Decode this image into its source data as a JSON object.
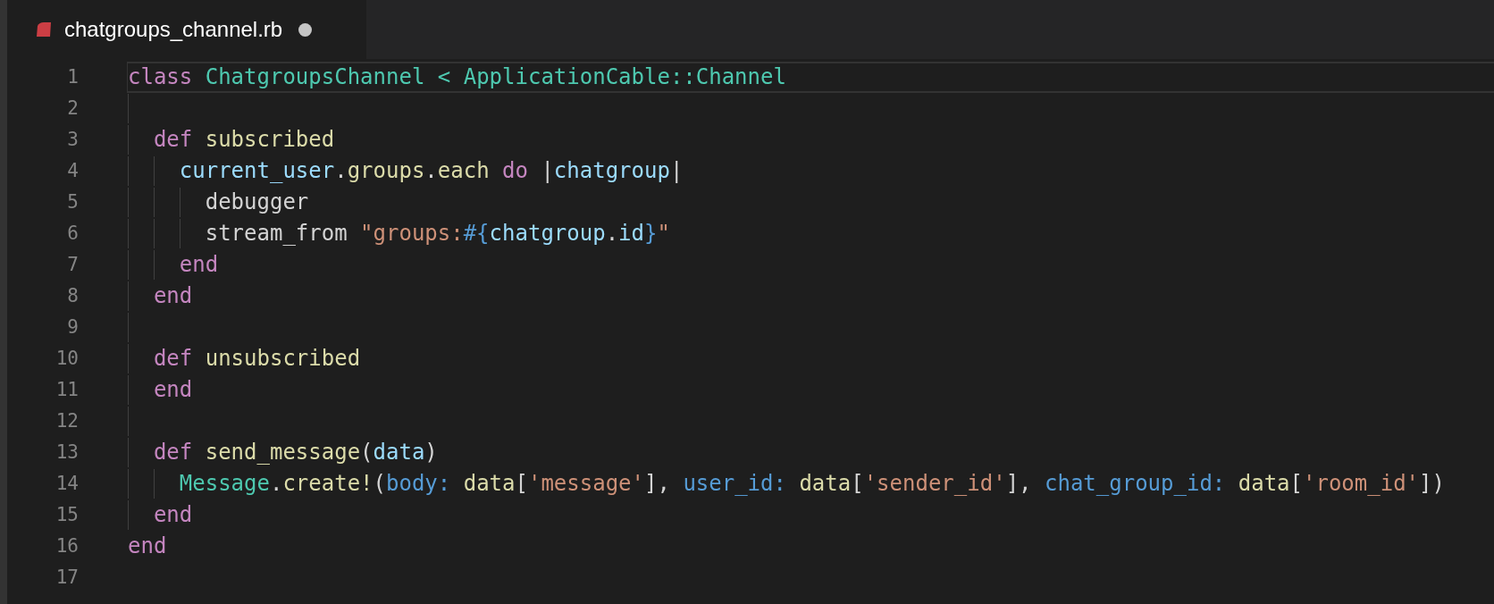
{
  "tab": {
    "title": "chatgroups_channel.rb",
    "modified": true,
    "selected": true
  },
  "lines": [
    {
      "number": "1",
      "current": true,
      "tokens": [
        {
          "kind": "keyword",
          "text": "class "
        },
        {
          "kind": "type",
          "text": "ChatgroupsChannel < ApplicationCable::Channel"
        }
      ],
      "children": [
        {
          "number": "2",
          "current": false
        },
        {
          "number": "3",
          "current": false,
          "tokens": [
            {
              "kind": "keyword",
              "text": "def "
            },
            {
              "kind": "function",
              "text": "subscribed"
            }
          ],
          "children": [
            {
              "number": "4",
              "current": false,
              "tokens": [
                {
                  "kind": "variable",
                  "text": "current_user"
                },
                {
                  "kind": "plain",
                  "text": "."
                },
                {
                  "kind": "function",
                  "text": "groups"
                },
                {
                  "kind": "plain",
                  "text": "."
                },
                {
                  "kind": "function",
                  "text": "each"
                },
                {
                  "kind": "keyword",
                  "text": " do"
                },
                {
                  "kind": "plain",
                  "text": " |"
                },
                {
                  "kind": "variable",
                  "text": "chatgroup"
                },
                {
                  "kind": "plain",
                  "text": "|"
                }
              ],
              "children": [
                {
                  "number": "5",
                  "current": false,
                  "tokens": [
                    {
                      "kind": "plain",
                      "text": "debugger"
                    }
                  ]
                },
                {
                  "number": "6",
                  "current": false,
                  "tokens": [
                    {
                      "kind": "plain",
                      "text": "stream_from "
                    },
                    {
                      "kind": "string",
                      "text": "\"groups:"
                    },
                    {
                      "kind": "symbol",
                      "text": "#{"
                    },
                    {
                      "kind": "variable",
                      "text": "chatgroup"
                    },
                    {
                      "kind": "plain",
                      "text": "."
                    },
                    {
                      "kind": "variable",
                      "text": "id"
                    },
                    {
                      "kind": "symbol",
                      "text": "}"
                    },
                    {
                      "kind": "string",
                      "text": "\""
                    }
                  ]
                }
              ]
            },
            {
              "number": "7",
              "current": false,
              "tokens": [
                {
                  "kind": "keyword",
                  "text": "end"
                }
              ]
            }
          ]
        },
        {
          "number": "8",
          "current": false,
          "tokens": [
            {
              "kind": "keyword",
              "text": "end"
            }
          ]
        },
        {
          "number": "9",
          "current": false
        },
        {
          "number": "10",
          "current": false,
          "tokens": [
            {
              "kind": "keyword",
              "text": "def "
            },
            {
              "kind": "function",
              "text": "unsubscribed"
            }
          ]
        },
        {
          "number": "11",
          "current": false,
          "tokens": [
            {
              "kind": "keyword",
              "text": "end"
            }
          ]
        },
        {
          "number": "12",
          "current": false
        },
        {
          "number": "13",
          "current": false,
          "tokens": [
            {
              "kind": "keyword",
              "text": "def "
            },
            {
              "kind": "function",
              "text": "send_message"
            },
            {
              "kind": "plain",
              "text": "("
            },
            {
              "kind": "variable",
              "text": "data"
            },
            {
              "kind": "plain",
              "text": ")"
            }
          ],
          "children": [
            {
              "number": "14",
              "current": false,
              "tokens": [
                {
                  "kind": "type",
                  "text": "Message"
                },
                {
                  "kind": "plain",
                  "text": "."
                },
                {
                  "kind": "function",
                  "text": "create!"
                },
                {
                  "kind": "plain",
                  "text": "("
                },
                {
                  "kind": "symbol",
                  "text": "body:"
                },
                {
                  "kind": "function",
                  "text": " data"
                },
                {
                  "kind": "plain",
                  "text": "["
                },
                {
                  "kind": "string",
                  "text": "'message'"
                },
                {
                  "kind": "plain",
                  "text": "], "
                },
                {
                  "kind": "symbol",
                  "text": "user_id:"
                },
                {
                  "kind": "function",
                  "text": " data"
                },
                {
                  "kind": "plain",
                  "text": "["
                },
                {
                  "kind": "string",
                  "text": "'sender_id'"
                },
                {
                  "kind": "plain",
                  "text": "], "
                },
                {
                  "kind": "symbol",
                  "text": "chat_group_id:"
                },
                {
                  "kind": "function",
                  "text": " data"
                },
                {
                  "kind": "plain",
                  "text": "["
                },
                {
                  "kind": "string",
                  "text": "'room_id'"
                },
                {
                  "kind": "plain",
                  "text": "])"
                }
              ]
            }
          ]
        },
        {
          "number": "15",
          "current": false,
          "tokens": [
            {
              "kind": "keyword",
              "text": "end"
            }
          ]
        }
      ]
    },
    {
      "number": "16",
      "current": false,
      "tokens": [
        {
          "kind": "keyword",
          "text": "end"
        }
      ]
    },
    {
      "number": "17",
      "current": false
    }
  ]
}
